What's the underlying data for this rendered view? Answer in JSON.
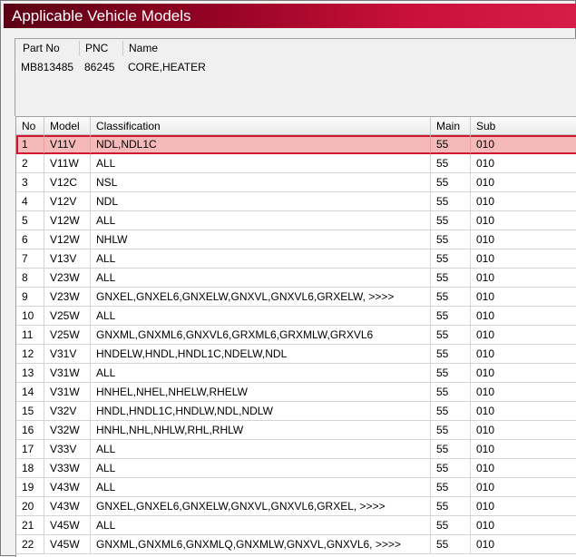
{
  "window": {
    "title": "Applicable Vehicle Models"
  },
  "part_info": {
    "headers": {
      "part_no": "Part No",
      "pnc": "PNC",
      "name": "Name"
    },
    "values": {
      "part_no": "MB813485",
      "pnc": "86245",
      "name": "CORE,HEATER"
    }
  },
  "grid": {
    "headers": {
      "no": "No",
      "model": "Model",
      "classification": "Classification",
      "main": "Main",
      "sub": "Sub"
    },
    "selected_row": 1,
    "rows": [
      {
        "no": "1",
        "model": "V11V",
        "classification": "NDL,NDL1C",
        "main": "55",
        "sub": "010"
      },
      {
        "no": "2",
        "model": "V11W",
        "classification": "ALL",
        "main": "55",
        "sub": "010"
      },
      {
        "no": "3",
        "model": "V12C",
        "classification": "NSL",
        "main": "55",
        "sub": "010"
      },
      {
        "no": "4",
        "model": "V12V",
        "classification": "NDL",
        "main": "55",
        "sub": "010"
      },
      {
        "no": "5",
        "model": "V12W",
        "classification": "ALL",
        "main": "55",
        "sub": "010"
      },
      {
        "no": "6",
        "model": "V12W",
        "classification": "NHLW",
        "main": "55",
        "sub": "010"
      },
      {
        "no": "7",
        "model": "V13V",
        "classification": "ALL",
        "main": "55",
        "sub": "010"
      },
      {
        "no": "8",
        "model": "V23W",
        "classification": "ALL",
        "main": "55",
        "sub": "010"
      },
      {
        "no": "9",
        "model": "V23W",
        "classification": "GNXEL,GNXEL6,GNXELW,GNXVL,GNXVL6,GRXELW,  >>>>",
        "main": "55",
        "sub": "010"
      },
      {
        "no": "10",
        "model": "V25W",
        "classification": "ALL",
        "main": "55",
        "sub": "010"
      },
      {
        "no": "11",
        "model": "V25W",
        "classification": "GNXML,GNXML6,GNXVL6,GRXML6,GRXMLW,GRXVL6",
        "main": "55",
        "sub": "010"
      },
      {
        "no": "12",
        "model": "V31V",
        "classification": "HNDELW,HNDL,HNDL1C,NDELW,NDL",
        "main": "55",
        "sub": "010"
      },
      {
        "no": "13",
        "model": "V31W",
        "classification": "ALL",
        "main": "55",
        "sub": "010"
      },
      {
        "no": "14",
        "model": "V31W",
        "classification": "HNHEL,NHEL,NHELW,RHELW",
        "main": "55",
        "sub": "010"
      },
      {
        "no": "15",
        "model": "V32V",
        "classification": "HNDL,HNDL1C,HNDLW,NDL,NDLW",
        "main": "55",
        "sub": "010"
      },
      {
        "no": "16",
        "model": "V32W",
        "classification": "HNHL,NHL,NHLW,RHL,RHLW",
        "main": "55",
        "sub": "010"
      },
      {
        "no": "17",
        "model": "V33V",
        "classification": "ALL",
        "main": "55",
        "sub": "010"
      },
      {
        "no": "18",
        "model": "V33W",
        "classification": "ALL",
        "main": "55",
        "sub": "010"
      },
      {
        "no": "19",
        "model": "V43W",
        "classification": "ALL",
        "main": "55",
        "sub": "010"
      },
      {
        "no": "20",
        "model": "V43W",
        "classification": "GNXEL,GNXEL6,GNXELW,GNXVL,GNXVL6,GRXEL,  >>>>",
        "main": "55",
        "sub": "010"
      },
      {
        "no": "21",
        "model": "V45W",
        "classification": "ALL",
        "main": "55",
        "sub": "010"
      },
      {
        "no": "22",
        "model": "V45W",
        "classification": "GNXML,GNXML6,GNXMLQ,GNXMLW,GNXVL,GNXVL6,  >>>>",
        "main": "55",
        "sub": "010"
      }
    ]
  },
  "colors": {
    "title_gradient_start": "#5a0014",
    "title_gradient_end": "#d81c48",
    "selection_fill": "#f6b9b9",
    "selection_border": "#d01830"
  }
}
